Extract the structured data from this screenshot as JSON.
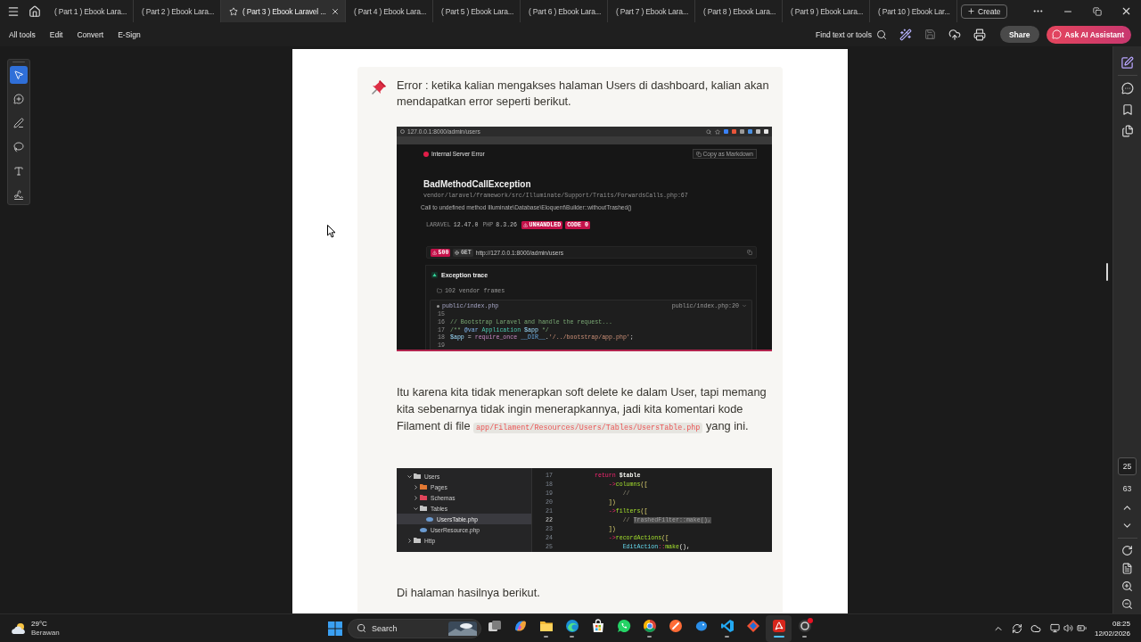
{
  "title_bar": {
    "tabs": [
      {
        "label": "( Part 1 ) Ebook Lara...",
        "selected": false
      },
      {
        "label": "( Part 2 ) Ebook Lara...",
        "selected": false
      },
      {
        "label": "( Part 3 ) Ebook Laravel ...",
        "selected": true
      },
      {
        "label": "( Part 4 ) Ebook Lara...",
        "selected": false
      },
      {
        "label": "( Part 5 ) Ebook Lara...",
        "selected": false
      },
      {
        "label": "( Part 6 ) Ebook Lara...",
        "selected": false
      },
      {
        "label": "( Part 7 ) Ebook Lara...",
        "selected": false
      },
      {
        "label": "( Part 8 ) Ebook Lara...",
        "selected": false
      },
      {
        "label": "( Part 9 ) Ebook Lara...",
        "selected": false
      },
      {
        "label": "( Part 10 ) Ebook Lar...",
        "selected": false
      }
    ],
    "create_button": "Create"
  },
  "toolbar": {
    "menu": [
      "All tools",
      "Edit",
      "Convert",
      "E-Sign"
    ],
    "search_label": "Find text or tools",
    "share_button": "Share",
    "ai_button": "Ask AI Assistant"
  },
  "left_tools": [
    {
      "selected": true
    },
    {
      "selected": false
    },
    {
      "selected": false
    },
    {
      "selected": false
    },
    {
      "selected": false
    },
    {
      "selected": false
    }
  ],
  "document": {
    "callout_text": "Error : ketika kalian mengakses halaman Users di dashboard, kalian akan mendapatkan error seperti berikut.",
    "error_screenshot": {
      "address": "127.0.0.1:8000/admin/users",
      "status": "Internal Server Error",
      "copy_button": "Copy as Markdown",
      "exception": "BadMethodCallException",
      "source_path": "vendor/laravel/framework/src/Illuminate/Support/Traits/ForwardsCalls.php:67",
      "message": "Call to undefined method Illuminate\\Database\\Eloquent\\Builder::withoutTrashed()",
      "versions": [
        {
          "label": "LARAVEL",
          "value": "12.47.0"
        },
        {
          "label": "PHP",
          "value": "8.3.26"
        }
      ],
      "badges": [
        {
          "kind": "warning",
          "text": "UNHANDLED"
        },
        {
          "kind": "plain",
          "text": "CODE 0"
        }
      ],
      "request": {
        "status": "500",
        "method": "GET",
        "url": "http://127.0.0.1:8000/admin/users"
      },
      "trace_title": "Exception trace",
      "vendor_frames": "102 vendor frames",
      "frame": {
        "file": "public/index.php",
        "location": "public/index.php:20",
        "lines": [
          {
            "number": "15"
          },
          {
            "number": "16",
            "tokens": [
              {
                "kind": "comment",
                "text": "// Bootstrap Laravel and handle the request..."
              }
            ]
          },
          {
            "number": "17",
            "tokens": [
              {
                "kind": "comment",
                "text": "/** "
              },
              {
                "kind": "tag",
                "text": "@var"
              },
              {
                "kind": "type",
                "text": " Application"
              },
              {
                "kind": "variable",
                "text": " $app"
              },
              {
                "kind": "comment",
                "text": " */"
              }
            ]
          },
          {
            "number": "18",
            "tokens": [
              {
                "kind": "variable",
                "text": "$app"
              },
              {
                "kind": "plain",
                "text": " = "
              },
              {
                "kind": "keyword",
                "text": "require_once"
              },
              {
                "kind": "constant",
                "text": " __DIR__"
              },
              {
                "kind": "plain",
                "text": "."
              },
              {
                "kind": "string",
                "text": "'/../bootstrap/app.php'"
              },
              {
                "kind": "plain",
                "text": ";"
              }
            ]
          },
          {
            "number": "19"
          }
        ]
      }
    },
    "paragraph": {
      "parts": [
        {
          "kind": "text",
          "text": "Itu karena kita tidak menerapkan soft delete ke dalam User, tapi memang kita sebenarnya tidak ingin menerapkannya, jadi kita komentari kode Filament di file "
        },
        {
          "kind": "code",
          "text": "app/Filament/Resources/Users/Tables/UsersTable.php"
        },
        {
          "kind": "text",
          "text": " yang ini."
        }
      ]
    },
    "editor_screenshot": {
      "tree": [
        {
          "kind": "folder",
          "label": "Users",
          "expanded": true,
          "selected": false,
          "color": "#c5c5c5",
          "children": [
            {
              "kind": "folder",
              "label": "Pages",
              "expanded": false,
              "selected": false,
              "color": "#e37933"
            },
            {
              "kind": "folder",
              "label": "Schemas",
              "expanded": false,
              "selected": false,
              "color": "#e0445a"
            },
            {
              "kind": "folder",
              "label": "Tables",
              "expanded": true,
              "selected": false,
              "color": "#c5c5c5",
              "children": [
                {
                  "kind": "file",
                  "label": "UsersTable.php",
                  "selected": true,
                  "color": "#6b9bd1"
                }
              ]
            },
            {
              "kind": "file",
              "label": "UserResource.php",
              "selected": false,
              "color": "#6b9bd1"
            }
          ]
        },
        {
          "kind": "folder",
          "label": "Http",
          "expanded": false,
          "selected": false,
          "color": "#c5c5c5"
        }
      ],
      "lines": [
        {
          "number": "17",
          "current": false,
          "tokens": [
            {
              "kind": "keyword",
              "text": "return"
            },
            {
              "kind": "variable",
              "text": " $table"
            }
          ]
        },
        {
          "number": "18",
          "current": false,
          "tokens": [
            {
              "kind": "operator",
              "text": "    ->"
            },
            {
              "kind": "method",
              "text": "columns"
            },
            {
              "kind": "bracket",
              "text": "(["
            }
          ]
        },
        {
          "number": "19",
          "current": false,
          "tokens": [
            {
              "kind": "comment",
              "text": "        //"
            }
          ]
        },
        {
          "number": "20",
          "current": false,
          "tokens": [
            {
              "kind": "bracket",
              "text": "    ])"
            }
          ]
        },
        {
          "number": "21",
          "current": false,
          "tokens": [
            {
              "kind": "operator",
              "text": "    ->"
            },
            {
              "kind": "method",
              "text": "filters"
            },
            {
              "kind": "bracket",
              "text": "(["
            }
          ]
        },
        {
          "number": "22",
          "current": true,
          "tokens": [
            {
              "kind": "comment",
              "text": "        // "
            },
            {
              "kind": "selection",
              "text": "TrashedFilter::make(),"
            }
          ]
        },
        {
          "number": "23",
          "current": false,
          "tokens": [
            {
              "kind": "bracket",
              "text": "    ])"
            }
          ]
        },
        {
          "number": "24",
          "current": false,
          "tokens": [
            {
              "kind": "operator",
              "text": "    ->"
            },
            {
              "kind": "method",
              "text": "recordActions"
            },
            {
              "kind": "bracket",
              "text": "(["
            }
          ]
        },
        {
          "number": "25",
          "current": false,
          "tokens": [
            {
              "kind": "class",
              "text": "        EditAction"
            },
            {
              "kind": "operator",
              "text": "::"
            },
            {
              "kind": "method",
              "text": "make"
            },
            {
              "kind": "plain",
              "text": "(),"
            }
          ]
        }
      ]
    },
    "closing_text": "Di halaman hasilnya berikut."
  },
  "right_panel": {
    "page_number": "25",
    "page_count": "63"
  },
  "taskbar": {
    "weather": {
      "temperature": "29°C",
      "condition": "Berawan"
    },
    "search": {
      "label": "Search"
    },
    "apps": [
      {
        "running": false,
        "selected": false,
        "notification": false
      },
      {
        "running": false,
        "selected": false,
        "notification": false
      },
      {
        "running": true,
        "selected": false,
        "notification": false
      },
      {
        "running": true,
        "selected": false,
        "notification": false
      },
      {
        "running": false,
        "selected": false,
        "notification": false
      },
      {
        "running": false,
        "selected": false,
        "notification": false
      },
      {
        "running": true,
        "selected": false,
        "notification": false
      },
      {
        "running": false,
        "selected": false,
        "notification": false
      },
      {
        "running": false,
        "selected": false,
        "notification": false
      },
      {
        "running": true,
        "selected": false,
        "notification": false
      },
      {
        "running": false,
        "selected": false,
        "notification": false
      },
      {
        "running": true,
        "selected": true,
        "notification": false
      },
      {
        "running": true,
        "selected": false,
        "notification": true
      }
    ],
    "clock": {
      "time": "08:25",
      "date": "12/02/2026"
    }
  }
}
